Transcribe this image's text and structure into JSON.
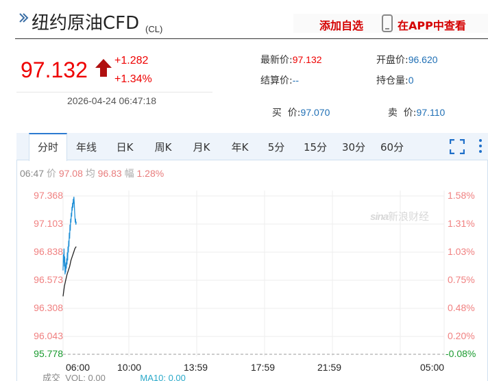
{
  "header": {
    "title": "纽约原油CFD",
    "code": "(CL)",
    "favorite_label": "添加自选",
    "app_label": "在APP中查看"
  },
  "quote": {
    "price": "97.132",
    "change": "+1.282",
    "change_pct": "+1.34%",
    "timestamp": "2026-04-24 06:47:18",
    "latest_label": "最新价:",
    "latest_value": "97.132",
    "open_label": "开盘价:",
    "open_value": "96.620",
    "settle_label": "结算价:",
    "settle_value": "--",
    "oi_label": "持仓量:",
    "oi_value": "0",
    "buy_label": "买  价:",
    "buy_value": "97.070",
    "sell_label": "卖  价:",
    "sell_value": "97.110"
  },
  "tabs": [
    "分时",
    "年线",
    "日K",
    "周K",
    "月K",
    "年K",
    "5分",
    "15分",
    "30分",
    "60分"
  ],
  "info": {
    "time": "06:47",
    "price_label": "价",
    "price_value": "97.08",
    "avg_label": "均",
    "avg_value": "96.83",
    "range_label": "幅",
    "range_value": "1.28%"
  },
  "chart_data": {
    "type": "line",
    "y_ticks_left": [
      "97.368",
      "97.103",
      "96.838",
      "96.573",
      "96.308",
      "96.043",
      "95.778"
    ],
    "y_ticks_right": [
      "1.58%",
      "1.31%",
      "1.03%",
      "0.75%",
      "0.48%",
      "0.20%",
      "-0.08%"
    ],
    "x_ticks": [
      "06:00",
      "10:00",
      "13:59",
      "17:59",
      "21:59",
      "05:00"
    ],
    "ylim": [
      95.778,
      97.368
    ],
    "baseline": 95.85,
    "series": [
      {
        "color": "#1f8fd6",
        "x": [
          0,
          1,
          2,
          3,
          4,
          5,
          6,
          7,
          8,
          9,
          10,
          11,
          12,
          13,
          14,
          15,
          16,
          17,
          18,
          19,
          20,
          21,
          22,
          23,
          24,
          25,
          26,
          27,
          28,
          29,
          30,
          31,
          32,
          33,
          34,
          35,
          36,
          37,
          38,
          39,
          40
        ],
        "y": [
          96.62,
          96.78,
          96.7,
          96.84,
          96.66,
          96.76,
          96.58,
          96.68,
          96.6,
          96.7,
          96.64,
          96.74,
          96.68,
          96.8,
          96.72,
          96.86,
          96.8,
          96.92,
          96.86,
          97.0,
          96.94,
          97.08,
          97.02,
          97.14,
          97.1,
          97.2,
          97.16,
          97.26,
          97.22,
          97.3,
          97.25,
          97.34,
          97.29,
          97.36,
          97.3,
          97.22,
          97.16,
          97.1,
          97.14,
          97.08,
          97.11
        ]
      },
      {
        "color": "#222222",
        "x": [
          0,
          4,
          8,
          12,
          16,
          20,
          24,
          28,
          32,
          36,
          40
        ],
        "y": [
          96.36,
          96.46,
          96.52,
          96.58,
          96.62,
          96.66,
          96.72,
          96.76,
          96.8,
          96.84,
          96.86
        ]
      }
    ]
  },
  "footer": {
    "volume_label": "成交",
    "vol_label": "VOL:",
    "vol_value": "0.00",
    "ma_label": "MA10:",
    "ma_value": "0.00"
  },
  "watermark": {
    "brand": "sina",
    "brand_cn": "新浪财经"
  },
  "colors": {
    "up": "#e00000",
    "accent": "#d40000",
    "left_axis": "#f08080",
    "negative": "#199a2e",
    "price_line": "#1f8fd6",
    "avg_line": "#222222"
  }
}
